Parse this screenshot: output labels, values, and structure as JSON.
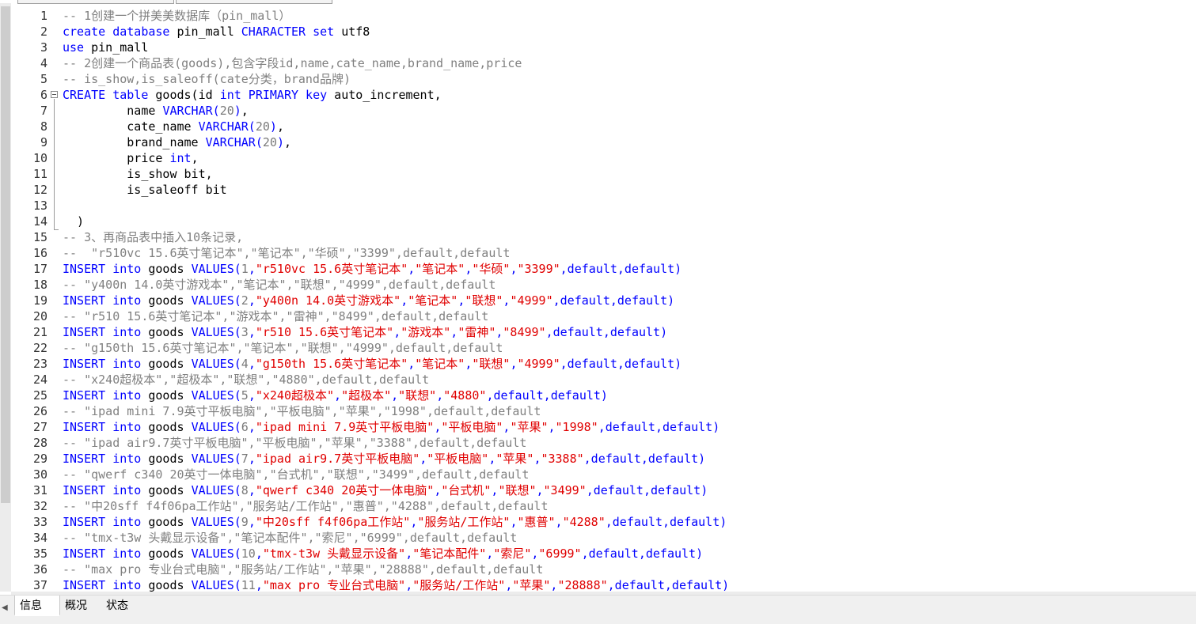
{
  "line_numbers": [
    "1",
    "2",
    "3",
    "4",
    "5",
    "6",
    "7",
    "8",
    "9",
    "10",
    "11",
    "12",
    "13",
    "14",
    "15",
    "16",
    "17",
    "18",
    "19",
    "20",
    "21",
    "22",
    "23",
    "24",
    "25",
    "26",
    "27",
    "28",
    "29",
    "30",
    "31",
    "32",
    "33",
    "34",
    "35",
    "36",
    "37"
  ],
  "code_lines": [
    [
      {
        "t": "-- 1创建一个拼美美数据库（pin_mall）",
        "c": "cm"
      }
    ],
    [
      {
        "t": "create database",
        "c": "kw"
      },
      {
        "t": " pin_mall ",
        "c": ""
      },
      {
        "t": "CHARACTER set",
        "c": "kw"
      },
      {
        "t": " utf8",
        "c": ""
      }
    ],
    [
      {
        "t": "use",
        "c": "kw"
      },
      {
        "t": " pin_mall",
        "c": ""
      }
    ],
    [
      {
        "t": "-- 2创建一个商品表(goods),包含字段id,name,cate_name,brand_name,price",
        "c": "cm"
      }
    ],
    [
      {
        "t": "-- is_show,is_saleoff(cate分类，brand品牌)",
        "c": "cm"
      }
    ],
    [
      {
        "t": "CREATE table",
        "c": "kw"
      },
      {
        "t": " goods(id ",
        "c": ""
      },
      {
        "t": "int PRIMARY key",
        "c": "kw"
      },
      {
        "t": " auto_increment,",
        "c": ""
      }
    ],
    [
      {
        "t": "         name ",
        "c": ""
      },
      {
        "t": "VARCHAR(",
        "c": "kw"
      },
      {
        "t": "20",
        "c": "nm"
      },
      {
        "t": ")",
        "c": "kw"
      },
      {
        "t": ",",
        "c": ""
      }
    ],
    [
      {
        "t": "         cate_name ",
        "c": ""
      },
      {
        "t": "VARCHAR(",
        "c": "kw"
      },
      {
        "t": "20",
        "c": "nm"
      },
      {
        "t": ")",
        "c": "kw"
      },
      {
        "t": ",",
        "c": ""
      }
    ],
    [
      {
        "t": "         brand_name ",
        "c": ""
      },
      {
        "t": "VARCHAR(",
        "c": "kw"
      },
      {
        "t": "20",
        "c": "nm"
      },
      {
        "t": ")",
        "c": "kw"
      },
      {
        "t": ",",
        "c": ""
      }
    ],
    [
      {
        "t": "         price ",
        "c": ""
      },
      {
        "t": "int",
        "c": "kw"
      },
      {
        "t": ",",
        "c": ""
      }
    ],
    [
      {
        "t": "         is_show bit,",
        "c": ""
      }
    ],
    [
      {
        "t": "         is_saleoff bit",
        "c": ""
      }
    ],
    [
      {
        "t": "",
        "c": ""
      }
    ],
    [
      {
        "t": "  )",
        "c": ""
      }
    ],
    [
      {
        "t": "-- 3、再商品表中插入10条记录,",
        "c": "cm"
      }
    ],
    [
      {
        "t": "--  \"r510vc 15.6英寸笔记本\",\"笔记本\",\"华硕\",\"3399\",default,default",
        "c": "cm"
      }
    ],
    [
      {
        "t": "INSERT into",
        "c": "kw"
      },
      {
        "t": " goods ",
        "c": ""
      },
      {
        "t": "VALUES(",
        "c": "kw"
      },
      {
        "t": "1",
        "c": "nm"
      },
      {
        "t": ",",
        "c": "kw"
      },
      {
        "t": "\"r510vc 15.6英寸笔记本\"",
        "c": "st"
      },
      {
        "t": ",",
        "c": "kw"
      },
      {
        "t": "\"笔记本\"",
        "c": "st"
      },
      {
        "t": ",",
        "c": "kw"
      },
      {
        "t": "\"华硕\"",
        "c": "st"
      },
      {
        "t": ",",
        "c": "kw"
      },
      {
        "t": "\"3399\"",
        "c": "st"
      },
      {
        "t": ",default,default)",
        "c": "kw"
      }
    ],
    [
      {
        "t": "-- \"y400n 14.0英寸游戏本\",\"笔记本\",\"联想\",\"4999\",default,default",
        "c": "cm"
      }
    ],
    [
      {
        "t": "INSERT into",
        "c": "kw"
      },
      {
        "t": " goods ",
        "c": ""
      },
      {
        "t": "VALUES(",
        "c": "kw"
      },
      {
        "t": "2",
        "c": "nm"
      },
      {
        "t": ",",
        "c": "kw"
      },
      {
        "t": "\"y400n 14.0英寸游戏本\"",
        "c": "st"
      },
      {
        "t": ",",
        "c": "kw"
      },
      {
        "t": "\"笔记本\"",
        "c": "st"
      },
      {
        "t": ",",
        "c": "kw"
      },
      {
        "t": "\"联想\"",
        "c": "st"
      },
      {
        "t": ",",
        "c": "kw"
      },
      {
        "t": "\"4999\"",
        "c": "st"
      },
      {
        "t": ",default,default)",
        "c": "kw"
      }
    ],
    [
      {
        "t": "-- \"r510 15.6英寸笔记本\",\"游戏本\",\"雷神\",\"8499\",default,default",
        "c": "cm"
      }
    ],
    [
      {
        "t": "INSERT into",
        "c": "kw"
      },
      {
        "t": " goods ",
        "c": ""
      },
      {
        "t": "VALUES(",
        "c": "kw"
      },
      {
        "t": "3",
        "c": "nm"
      },
      {
        "t": ",",
        "c": "kw"
      },
      {
        "t": "\"r510 15.6英寸笔记本\"",
        "c": "st"
      },
      {
        "t": ",",
        "c": "kw"
      },
      {
        "t": "\"游戏本\"",
        "c": "st"
      },
      {
        "t": ",",
        "c": "kw"
      },
      {
        "t": "\"雷神\"",
        "c": "st"
      },
      {
        "t": ",",
        "c": "kw"
      },
      {
        "t": "\"8499\"",
        "c": "st"
      },
      {
        "t": ",default,default)",
        "c": "kw"
      }
    ],
    [
      {
        "t": "-- \"g150th 15.6英寸笔记本\",\"笔记本\",\"联想\",\"4999\",default,default",
        "c": "cm"
      }
    ],
    [
      {
        "t": "INSERT into",
        "c": "kw"
      },
      {
        "t": " goods ",
        "c": ""
      },
      {
        "t": "VALUES(",
        "c": "kw"
      },
      {
        "t": "4",
        "c": "nm"
      },
      {
        "t": ",",
        "c": "kw"
      },
      {
        "t": "\"g150th 15.6英寸笔记本\"",
        "c": "st"
      },
      {
        "t": ",",
        "c": "kw"
      },
      {
        "t": "\"笔记本\"",
        "c": "st"
      },
      {
        "t": ",",
        "c": "kw"
      },
      {
        "t": "\"联想\"",
        "c": "st"
      },
      {
        "t": ",",
        "c": "kw"
      },
      {
        "t": "\"4999\"",
        "c": "st"
      },
      {
        "t": ",default,default)",
        "c": "kw"
      }
    ],
    [
      {
        "t": "-- \"x240超极本\",\"超极本\",\"联想\",\"4880\",default,default",
        "c": "cm"
      }
    ],
    [
      {
        "t": "INSERT into",
        "c": "kw"
      },
      {
        "t": " goods ",
        "c": ""
      },
      {
        "t": "VALUES(",
        "c": "kw"
      },
      {
        "t": "5",
        "c": "nm"
      },
      {
        "t": ",",
        "c": "kw"
      },
      {
        "t": "\"x240超极本\"",
        "c": "st"
      },
      {
        "t": ",",
        "c": "kw"
      },
      {
        "t": "\"超极本\"",
        "c": "st"
      },
      {
        "t": ",",
        "c": "kw"
      },
      {
        "t": "\"联想\"",
        "c": "st"
      },
      {
        "t": ",",
        "c": "kw"
      },
      {
        "t": "\"4880\"",
        "c": "st"
      },
      {
        "t": ",default,default)",
        "c": "kw"
      }
    ],
    [
      {
        "t": "-- \"ipad mini 7.9英寸平板电脑\",\"平板电脑\",\"苹果\",\"1998\",default,default",
        "c": "cm"
      }
    ],
    [
      {
        "t": "INSERT into",
        "c": "kw"
      },
      {
        "t": " goods ",
        "c": ""
      },
      {
        "t": "VALUES(",
        "c": "kw"
      },
      {
        "t": "6",
        "c": "nm"
      },
      {
        "t": ",",
        "c": "kw"
      },
      {
        "t": "\"ipad mini 7.9英寸平板电脑\"",
        "c": "st"
      },
      {
        "t": ",",
        "c": "kw"
      },
      {
        "t": "\"平板电脑\"",
        "c": "st"
      },
      {
        "t": ",",
        "c": "kw"
      },
      {
        "t": "\"苹果\"",
        "c": "st"
      },
      {
        "t": ",",
        "c": "kw"
      },
      {
        "t": "\"1998\"",
        "c": "st"
      },
      {
        "t": ",default,default)",
        "c": "kw"
      }
    ],
    [
      {
        "t": "-- \"ipad air9.7英寸平板电脑\",\"平板电脑\",\"苹果\",\"3388\",default,default",
        "c": "cm"
      }
    ],
    [
      {
        "t": "INSERT into",
        "c": "kw"
      },
      {
        "t": " goods ",
        "c": ""
      },
      {
        "t": "VALUES(",
        "c": "kw"
      },
      {
        "t": "7",
        "c": "nm"
      },
      {
        "t": ",",
        "c": "kw"
      },
      {
        "t": "\"ipad air9.7英寸平板电脑\"",
        "c": "st"
      },
      {
        "t": ",",
        "c": "kw"
      },
      {
        "t": "\"平板电脑\"",
        "c": "st"
      },
      {
        "t": ",",
        "c": "kw"
      },
      {
        "t": "\"苹果\"",
        "c": "st"
      },
      {
        "t": ",",
        "c": "kw"
      },
      {
        "t": "\"3388\"",
        "c": "st"
      },
      {
        "t": ",default,default)",
        "c": "kw"
      }
    ],
    [
      {
        "t": "-- \"qwerf c340 20英寸一体电脑\",\"台式机\",\"联想\",\"3499\",default,default",
        "c": "cm"
      }
    ],
    [
      {
        "t": "INSERT into",
        "c": "kw"
      },
      {
        "t": " goods ",
        "c": ""
      },
      {
        "t": "VALUES(",
        "c": "kw"
      },
      {
        "t": "8",
        "c": "nm"
      },
      {
        "t": ",",
        "c": "kw"
      },
      {
        "t": "\"qwerf c340 20英寸一体电脑\"",
        "c": "st"
      },
      {
        "t": ",",
        "c": "kw"
      },
      {
        "t": "\"台式机\"",
        "c": "st"
      },
      {
        "t": ",",
        "c": "kw"
      },
      {
        "t": "\"联想\"",
        "c": "st"
      },
      {
        "t": ",",
        "c": "kw"
      },
      {
        "t": "\"3499\"",
        "c": "st"
      },
      {
        "t": ",default,default)",
        "c": "kw"
      }
    ],
    [
      {
        "t": "-- \"中20sff f4f06pa工作站\",\"服务站/工作站\",\"惠普\",\"4288\",default,default",
        "c": "cm"
      }
    ],
    [
      {
        "t": "INSERT into",
        "c": "kw"
      },
      {
        "t": " goods ",
        "c": ""
      },
      {
        "t": "VALUES(",
        "c": "kw"
      },
      {
        "t": "9",
        "c": "nm"
      },
      {
        "t": ",",
        "c": "kw"
      },
      {
        "t": "\"中20sff f4f06pa工作站\"",
        "c": "st"
      },
      {
        "t": ",",
        "c": "kw"
      },
      {
        "t": "\"服务站/工作站\"",
        "c": "st"
      },
      {
        "t": ",",
        "c": "kw"
      },
      {
        "t": "\"惠普\"",
        "c": "st"
      },
      {
        "t": ",",
        "c": "kw"
      },
      {
        "t": "\"4288\"",
        "c": "st"
      },
      {
        "t": ",default,default)",
        "c": "kw"
      }
    ],
    [
      {
        "t": "-- \"tmx-t3w 头戴显示设备\",\"笔记本配件\",\"索尼\",\"6999\",default,default",
        "c": "cm"
      }
    ],
    [
      {
        "t": "INSERT into",
        "c": "kw"
      },
      {
        "t": " goods ",
        "c": ""
      },
      {
        "t": "VALUES(",
        "c": "kw"
      },
      {
        "t": "10",
        "c": "nm"
      },
      {
        "t": ",",
        "c": "kw"
      },
      {
        "t": "\"tmx-t3w 头戴显示设备\"",
        "c": "st"
      },
      {
        "t": ",",
        "c": "kw"
      },
      {
        "t": "\"笔记本配件\"",
        "c": "st"
      },
      {
        "t": ",",
        "c": "kw"
      },
      {
        "t": "\"索尼\"",
        "c": "st"
      },
      {
        "t": ",",
        "c": "kw"
      },
      {
        "t": "\"6999\"",
        "c": "st"
      },
      {
        "t": ",default,default)",
        "c": "kw"
      }
    ],
    [
      {
        "t": "-- \"max pro 专业台式电脑\",\"服务站/工作站\",\"苹果\",\"28888\",default,default",
        "c": "cm"
      }
    ],
    [
      {
        "t": "INSERT into",
        "c": "kw"
      },
      {
        "t": " goods ",
        "c": ""
      },
      {
        "t": "VALUES(",
        "c": "kw"
      },
      {
        "t": "11",
        "c": "nm"
      },
      {
        "t": ",",
        "c": "kw"
      },
      {
        "t": "\"max pro 专业台式电脑\"",
        "c": "st"
      },
      {
        "t": ",",
        "c": "kw"
      },
      {
        "t": "\"服务站/工作站\"",
        "c": "st"
      },
      {
        "t": ",",
        "c": "kw"
      },
      {
        "t": "\"苹果\"",
        "c": "st"
      },
      {
        "t": ",",
        "c": "kw"
      },
      {
        "t": "\"28888\"",
        "c": "st"
      },
      {
        "t": ",default,default)",
        "c": "kw"
      }
    ]
  ],
  "bottom_tabs": [
    {
      "label": "信息",
      "active": true
    },
    {
      "label": "概况",
      "active": false
    },
    {
      "label": "状态",
      "active": false
    }
  ],
  "colors": {
    "keyword": "#0000ff",
    "comment": "#808080",
    "string": "#e00000",
    "number": "#7a7a7a"
  }
}
